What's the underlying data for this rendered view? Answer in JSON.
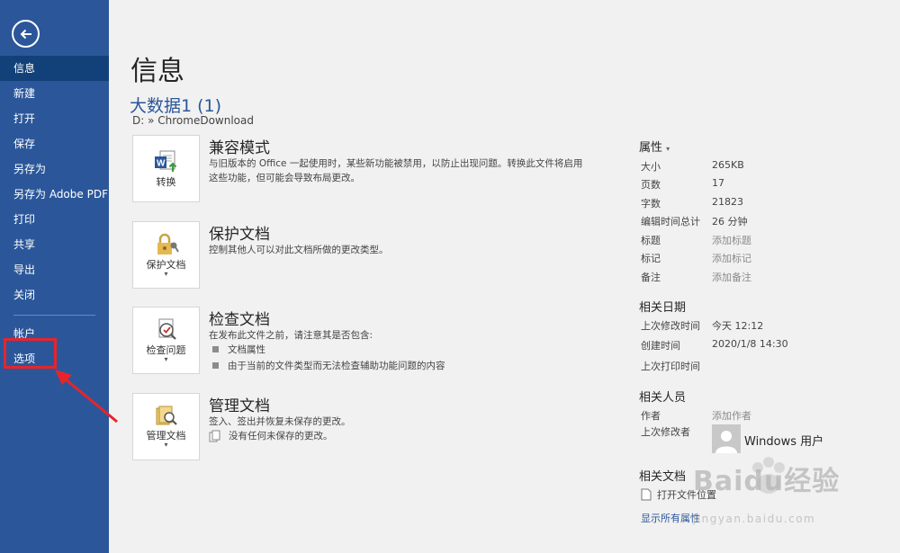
{
  "sidebar": {
    "items": [
      {
        "label": "信息"
      },
      {
        "label": "新建"
      },
      {
        "label": "打开"
      },
      {
        "label": "保存"
      },
      {
        "label": "另存为"
      },
      {
        "label": "另存为 Adobe PDF"
      },
      {
        "label": "打印"
      },
      {
        "label": "共享"
      },
      {
        "label": "导出"
      },
      {
        "label": "关闭"
      }
    ],
    "account": "帐户",
    "options": "选项"
  },
  "main": {
    "title": "信息",
    "doc_name": "大数据1 (1)",
    "doc_path": "D: » ChromeDownload",
    "sections": {
      "compat": {
        "tile": "转换",
        "heading": "兼容模式",
        "desc": "与旧版本的 Office 一起使用时，某些新功能被禁用，以防止出现问题。转换此文件将启用这些功能，但可能会导致布局更改。"
      },
      "protect": {
        "tile": "保护文档",
        "heading": "保护文档",
        "desc": "控制其他人可以对此文档所做的更改类型。"
      },
      "inspect": {
        "tile": "检查问题",
        "heading": "检查文档",
        "desc": "在发布此文件之前，请注意其是否包含:",
        "bullets": [
          "文档属性",
          "由于当前的文件类型而无法检查辅助功能问题的内容"
        ]
      },
      "manage": {
        "tile": "管理文档",
        "heading": "管理文档",
        "desc": "签入、签出并恢复未保存的更改。",
        "note": "没有任何未保存的更改。"
      }
    }
  },
  "props": {
    "heading": "属性",
    "rows": [
      {
        "key": "大小",
        "value": "265KB"
      },
      {
        "key": "页数",
        "value": "17"
      },
      {
        "key": "字数",
        "value": "21823"
      },
      {
        "key": "编辑时间总计",
        "value": "26 分钟"
      },
      {
        "key": "标题",
        "value": "添加标题"
      },
      {
        "key": "标记",
        "value": "添加标记"
      },
      {
        "key": "备注",
        "value": "添加备注"
      }
    ],
    "dates_heading": "相关日期",
    "dates": [
      {
        "key": "上次修改时间",
        "value": "今天 12:12"
      },
      {
        "key": "创建时间",
        "value": "2020/1/8 14:30"
      },
      {
        "key": "上次打印时间",
        "value": ""
      }
    ],
    "people_heading": "相关人员",
    "author_key": "作者",
    "author_value": "添加作者",
    "modifier_key": "上次修改者",
    "modifier_value": "Windows 用户",
    "docs_heading": "相关文档",
    "open_file": "打开文件位置",
    "show_all": "显示所有属性"
  },
  "watermark": {
    "text": "Baidu经验",
    "url": "jingyan.baidu.com"
  },
  "colors": {
    "sidebar": "#2b579a",
    "active": "#124078",
    "accent": "#2b579a",
    "highlight": "#e8242a"
  }
}
